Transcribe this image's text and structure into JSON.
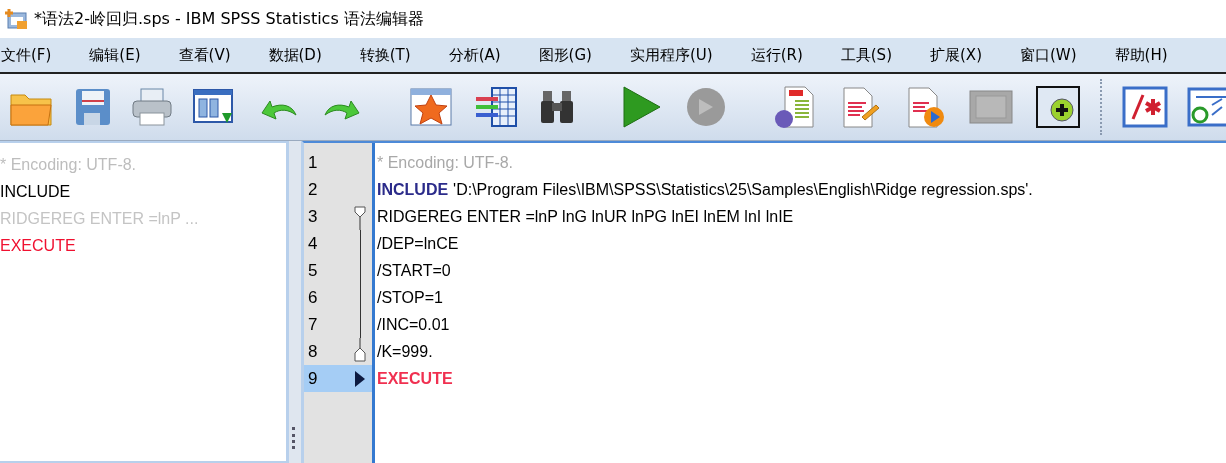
{
  "window": {
    "title": "*语法2-岭回归.sps - IBM SPSS Statistics 语法编辑器"
  },
  "menu": [
    "文件(F)",
    "编辑(E)",
    "查看(V)",
    "数据(D)",
    "转换(T)",
    "分析(A)",
    "图形(G)",
    "实用程序(U)",
    "运行(R)",
    "工具(S)",
    "扩展(X)",
    "窗口(W)",
    "帮助(H)"
  ],
  "outline": [
    {
      "text": "* Encoding: UTF-8.",
      "kind": "comment"
    },
    {
      "text": "INCLUDE",
      "kind": "command"
    },
    {
      "text": "RIDGEREG ENTER =lnP ...",
      "kind": "collapsed"
    },
    {
      "text": "EXECUTE",
      "kind": "execute"
    }
  ],
  "editor": {
    "lines": [
      {
        "number": "1",
        "kind": "comment",
        "fold_start": false,
        "fold_end": false,
        "in_fold": false,
        "selected": false,
        "text": "* Encoding: UTF-8."
      },
      {
        "number": "2",
        "kind": "command",
        "fold_start": false,
        "fold_end": false,
        "in_fold": false,
        "selected": false,
        "keyword": "INCLUDE",
        "text": "'D:\\Program Files\\IBM\\SPSS\\Statistics\\25\\Samples\\English\\Ridge regression.sps'."
      },
      {
        "number": "3",
        "kind": "plain",
        "fold_start": true,
        "fold_end": false,
        "in_fold": false,
        "selected": false,
        "text": "RIDGEREG ENTER =lnP lnG lnUR lnPG lnEI lnEM lnI lnIE"
      },
      {
        "number": "4",
        "kind": "plain",
        "fold_start": false,
        "fold_end": false,
        "in_fold": true,
        "selected": false,
        "text": "/DEP=lnCE"
      },
      {
        "number": "5",
        "kind": "plain",
        "fold_start": false,
        "fold_end": false,
        "in_fold": true,
        "selected": false,
        "text": "/START=0"
      },
      {
        "number": "6",
        "kind": "plain",
        "fold_start": false,
        "fold_end": false,
        "in_fold": true,
        "selected": false,
        "text": "/STOP=1"
      },
      {
        "number": "7",
        "kind": "plain",
        "fold_start": false,
        "fold_end": false,
        "in_fold": true,
        "selected": false,
        "text": "/INC=0.01"
      },
      {
        "number": "8",
        "kind": "plain",
        "fold_start": false,
        "fold_end": true,
        "in_fold": false,
        "selected": false,
        "text": "/K=999."
      },
      {
        "number": "9",
        "kind": "execute",
        "fold_start": false,
        "fold_end": false,
        "in_fold": false,
        "selected": true,
        "text": "EXECUTE"
      }
    ]
  }
}
